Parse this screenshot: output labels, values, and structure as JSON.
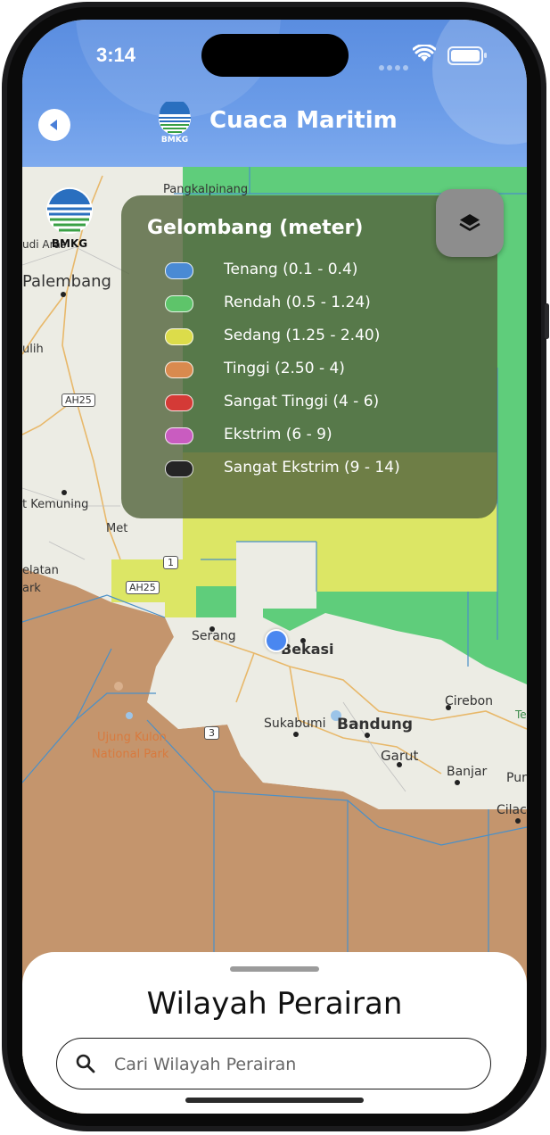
{
  "status_bar": {
    "time": "3:14"
  },
  "header": {
    "title": "Cuaca Maritim",
    "logo_text": "BMKG"
  },
  "map": {
    "logo_text": "BMKG",
    "labels": {
      "pangkal": "Pangkalpinang",
      "palembang": "Palembang",
      "sudi": "udi Aras",
      "julih": "ulih",
      "ah25a": "AH25",
      "kemuning": "t Kemuning",
      "met": "Met",
      "one": "1",
      "ah25b": "AH25",
      "selatan": "elatan",
      "ark": "ark",
      "serang": "Serang",
      "bekasi": "Bekasi",
      "cirebon": "Cirebon",
      "bandung": "Bandung",
      "sukabumi": "Sukabumi",
      "garut": "Garut",
      "banjar": "Banjar",
      "pur": "Pur",
      "cilac": "Cilac",
      "three": "3",
      "ujung_kulon": "Ujung Kulon",
      "national_park": "National Park",
      "te": "Te"
    }
  },
  "legend": {
    "title": "Gelombang (meter)",
    "items": [
      {
        "label": "Tenang (0.1 - 0.4)",
        "color": "#4a8ad4"
      },
      {
        "label": "Rendah (0.5 - 1.24)",
        "color": "#5ec46a"
      },
      {
        "label": "Sedang (1.25 - 2.40)",
        "color": "#dcdc4a"
      },
      {
        "label": "Tinggi (2.50 - 4)",
        "color": "#d98a4e"
      },
      {
        "label": "Sangat Tinggi (4 - 6)",
        "color": "#d43a36"
      },
      {
        "label": "Ekstrim (6 - 9)",
        "color": "#c95cc0"
      },
      {
        "label": "Sangat Ekstrim (9 - 14)",
        "color": "#252525"
      }
    ]
  },
  "sheet": {
    "title": "Wilayah Perairan",
    "search_placeholder": "Cari Wilayah Perairan"
  },
  "colors": {
    "header": "#6b9ce8",
    "sea_low": "#5fcd7b",
    "sea_medium": "#dce665",
    "sea_high": "#c4956d",
    "land": "#eeeee6"
  }
}
